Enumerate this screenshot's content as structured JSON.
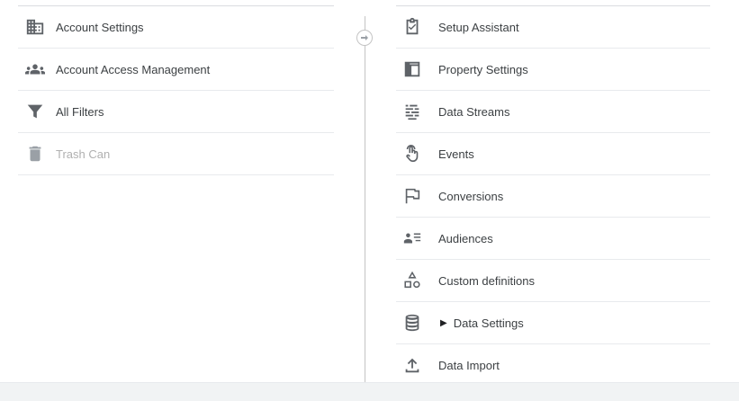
{
  "account_column": {
    "items": [
      {
        "label": "Account Settings",
        "icon": "building-icon"
      },
      {
        "label": "Account Access Management",
        "icon": "people-icon"
      },
      {
        "label": "All Filters",
        "icon": "filter-icon"
      },
      {
        "label": "Trash Can",
        "icon": "trash-icon",
        "disabled": true
      }
    ]
  },
  "property_column": {
    "items": [
      {
        "label": "Setup Assistant",
        "icon": "clipboard-check-icon"
      },
      {
        "label": "Property Settings",
        "icon": "property-layout-icon"
      },
      {
        "label": "Data Streams",
        "icon": "data-streams-icon"
      },
      {
        "label": "Events",
        "icon": "touch-icon"
      },
      {
        "label": "Conversions",
        "icon": "flag-icon"
      },
      {
        "label": "Audiences",
        "icon": "audience-icon"
      },
      {
        "label": "Custom definitions",
        "icon": "shapes-icon"
      },
      {
        "label": "Data Settings",
        "icon": "database-icon",
        "expandable": true
      },
      {
        "label": "Data Import",
        "icon": "upload-icon"
      }
    ]
  },
  "colors": {
    "icon": "#5f6368",
    "text": "#3c4043",
    "disabled_text": "#b0b0b0",
    "row_border": "#e8eaed",
    "bottom_bar": "#f1f3f4"
  }
}
